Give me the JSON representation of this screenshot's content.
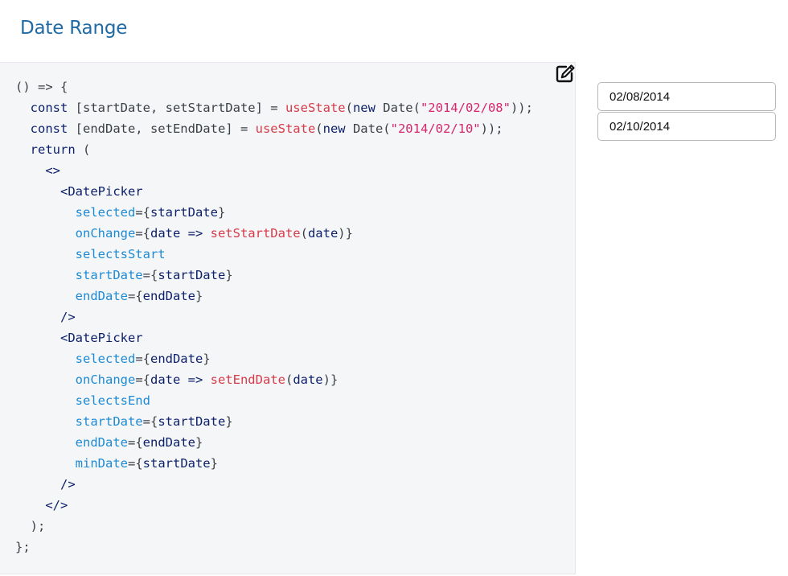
{
  "header": {
    "title": "Date Range"
  },
  "editor": {
    "edit_icon": "edit-icon",
    "lines": [
      [
        {
          "t": "() => {",
          "c": "plain"
        }
      ],
      [
        {
          "t": "  const ",
          "c": "kw"
        },
        {
          "t": "[startDate, setStartDate] = ",
          "c": "plain"
        },
        {
          "t": "useState",
          "c": "fn"
        },
        {
          "t": "(",
          "c": "pun"
        },
        {
          "t": "new",
          "c": "kw"
        },
        {
          "t": " Date(",
          "c": "plain"
        },
        {
          "t": "\"2014/02/08\"",
          "c": "str"
        },
        {
          "t": "));",
          "c": "pun"
        }
      ],
      [
        {
          "t": "  const ",
          "c": "kw"
        },
        {
          "t": "[endDate, setEndDate] = ",
          "c": "plain"
        },
        {
          "t": "useState",
          "c": "fn"
        },
        {
          "t": "(",
          "c": "pun"
        },
        {
          "t": "new",
          "c": "kw"
        },
        {
          "t": " Date(",
          "c": "plain"
        },
        {
          "t": "\"2014/02/10\"",
          "c": "str"
        },
        {
          "t": "));",
          "c": "pun"
        }
      ],
      [
        {
          "t": "  return ",
          "c": "kw"
        },
        {
          "t": "(",
          "c": "pun"
        }
      ],
      [
        {
          "t": "    <>",
          "c": "tag"
        }
      ],
      [
        {
          "t": "      <DatePicker",
          "c": "tag"
        }
      ],
      [
        {
          "t": "        selected",
          "c": "attr"
        },
        {
          "t": "={",
          "c": "pun"
        },
        {
          "t": "startDate",
          "c": "var"
        },
        {
          "t": "}",
          "c": "pun"
        }
      ],
      [
        {
          "t": "        onChange",
          "c": "attr"
        },
        {
          "t": "={",
          "c": "pun"
        },
        {
          "t": "date => ",
          "c": "var"
        },
        {
          "t": "setStartDate",
          "c": "fn"
        },
        {
          "t": "(",
          "c": "pun"
        },
        {
          "t": "date",
          "c": "var"
        },
        {
          "t": ")}",
          "c": "pun"
        }
      ],
      [
        {
          "t": "        selectsStart",
          "c": "attr"
        }
      ],
      [
        {
          "t": "        startDate",
          "c": "attr"
        },
        {
          "t": "={",
          "c": "pun"
        },
        {
          "t": "startDate",
          "c": "var"
        },
        {
          "t": "}",
          "c": "pun"
        }
      ],
      [
        {
          "t": "        endDate",
          "c": "attr"
        },
        {
          "t": "={",
          "c": "pun"
        },
        {
          "t": "endDate",
          "c": "var"
        },
        {
          "t": "}",
          "c": "pun"
        }
      ],
      [
        {
          "t": "      />",
          "c": "tag"
        }
      ],
      [
        {
          "t": "      <DatePicker",
          "c": "tag"
        }
      ],
      [
        {
          "t": "        selected",
          "c": "attr"
        },
        {
          "t": "={",
          "c": "pun"
        },
        {
          "t": "endDate",
          "c": "var"
        },
        {
          "t": "}",
          "c": "pun"
        }
      ],
      [
        {
          "t": "        onChange",
          "c": "attr"
        },
        {
          "t": "={",
          "c": "pun"
        },
        {
          "t": "date => ",
          "c": "var"
        },
        {
          "t": "setEndDate",
          "c": "fn"
        },
        {
          "t": "(",
          "c": "pun"
        },
        {
          "t": "date",
          "c": "var"
        },
        {
          "t": ")}",
          "c": "pun"
        }
      ],
      [
        {
          "t": "        selectsEnd",
          "c": "attr"
        }
      ],
      [
        {
          "t": "        startDate",
          "c": "attr"
        },
        {
          "t": "={",
          "c": "pun"
        },
        {
          "t": "startDate",
          "c": "var"
        },
        {
          "t": "}",
          "c": "pun"
        }
      ],
      [
        {
          "t": "        endDate",
          "c": "attr"
        },
        {
          "t": "={",
          "c": "pun"
        },
        {
          "t": "endDate",
          "c": "var"
        },
        {
          "t": "}",
          "c": "pun"
        }
      ],
      [
        {
          "t": "        minDate",
          "c": "attr"
        },
        {
          "t": "={",
          "c": "pun"
        },
        {
          "t": "startDate",
          "c": "var"
        },
        {
          "t": "}",
          "c": "pun"
        }
      ],
      [
        {
          "t": "      />",
          "c": "tag"
        }
      ],
      [
        {
          "t": "    </>",
          "c": "tag"
        }
      ],
      [
        {
          "t": "  );",
          "c": "pun"
        }
      ],
      [
        {
          "t": "};",
          "c": "pun"
        }
      ]
    ]
  },
  "preview": {
    "start_date": {
      "value": "02/08/2014"
    },
    "end_date": {
      "value": "02/10/2014"
    }
  }
}
